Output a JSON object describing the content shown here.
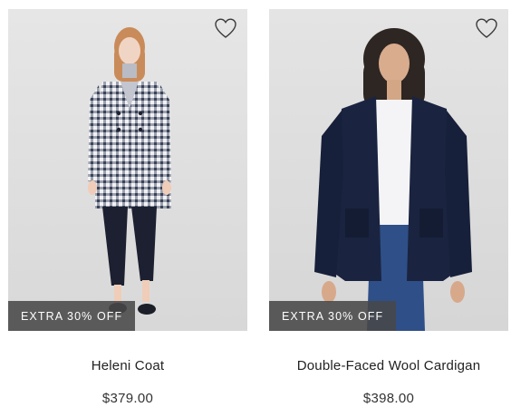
{
  "products": [
    {
      "name": "Heleni Coat",
      "price": "$379.00",
      "badge": "EXTRA 30% OFF",
      "image_desc": "woman-in-gingham-coat-image"
    },
    {
      "name": "Double-Faced Wool Cardigan",
      "price": "$398.00",
      "badge": "EXTRA 30% OFF",
      "image_desc": "woman-in-navy-cardigan-image"
    }
  ],
  "colors": {
    "badge_bg": "#484848",
    "image_bg": "#e2e2e2",
    "text": "#222222"
  },
  "icons": {
    "wishlist": "heart-outline-icon"
  }
}
